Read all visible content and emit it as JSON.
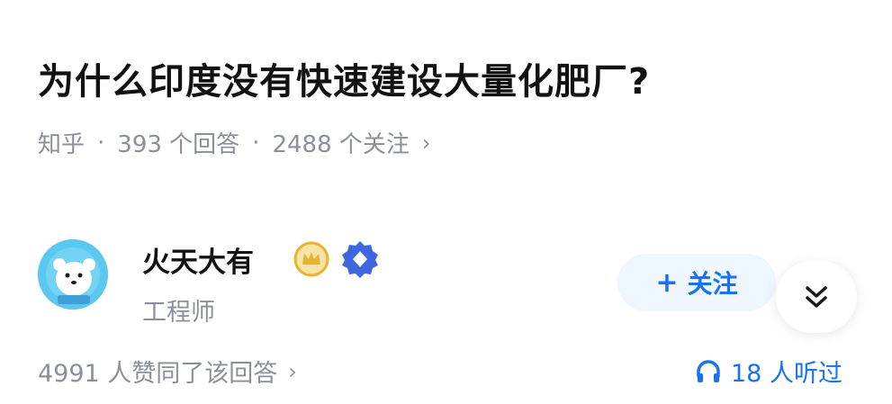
{
  "question": {
    "title": "为什么印度没有快速建设大量化肥厂?",
    "source": "知乎",
    "separator": "·",
    "answers": "393 个回答",
    "followers": "2488 个关注",
    "chevron": "›"
  },
  "author": {
    "name": "火天大有",
    "title": "工程师",
    "avatar_icon": "bear-avatar",
    "badges": [
      "crown-badge-icon",
      "diamond-badge-icon"
    ]
  },
  "actions": {
    "follow_plus": "+",
    "follow_label": "关注",
    "expand_icon": "double-chevron-down-icon"
  },
  "answer_stats": {
    "likes": "4991 人赞同了该回答",
    "chevron": "›",
    "listeners": "18 人听过",
    "listen_icon": "headphones-icon"
  },
  "colors": {
    "accent": "#1772f6",
    "meta_gray": "#8a8f99",
    "follow_bg": "#eef6ff",
    "crown": "#e8b32e",
    "diamond": "#3d67e0",
    "avatar_bg": "#5cc8f0"
  }
}
